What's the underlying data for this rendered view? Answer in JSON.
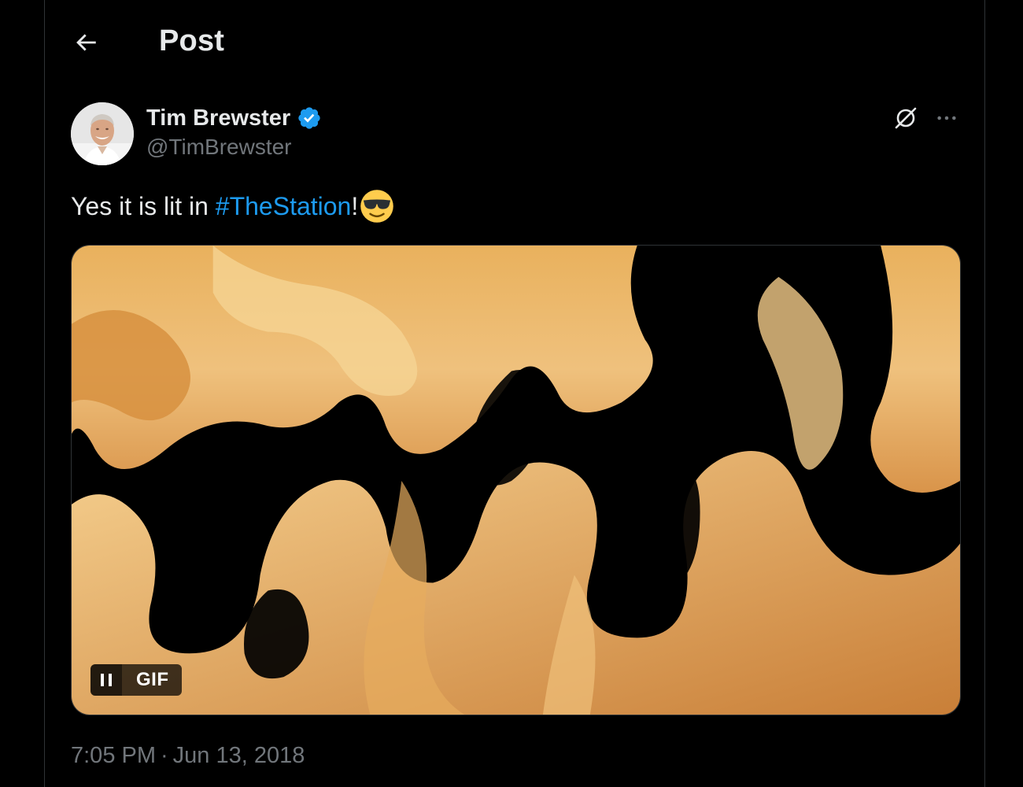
{
  "header": {
    "title": "Post",
    "back_icon": "arrow-left-icon"
  },
  "author": {
    "display_name": "Tim Brewster",
    "handle": "@TimBrewster",
    "verified": true,
    "verified_color": "#1d9bf0"
  },
  "actions": {
    "grok_icon": "grok-icon",
    "more_icon": "more-horizontal-icon"
  },
  "tweet": {
    "text_prefix": "Yes it is lit in ",
    "hashtag": "#TheStation",
    "text_suffix": "!",
    "emoji": "smiling-face-with-sunglasses"
  },
  "media": {
    "type": "GIF",
    "badge_label": "GIF",
    "control_icon": "pause-icon"
  },
  "meta": {
    "time": "7:05 PM",
    "separator": "·",
    "date": "Jun 13, 2018"
  },
  "colors": {
    "background": "#000000",
    "text_primary": "#e7e9ea",
    "text_secondary": "#71767b",
    "accent": "#1d9bf0"
  }
}
